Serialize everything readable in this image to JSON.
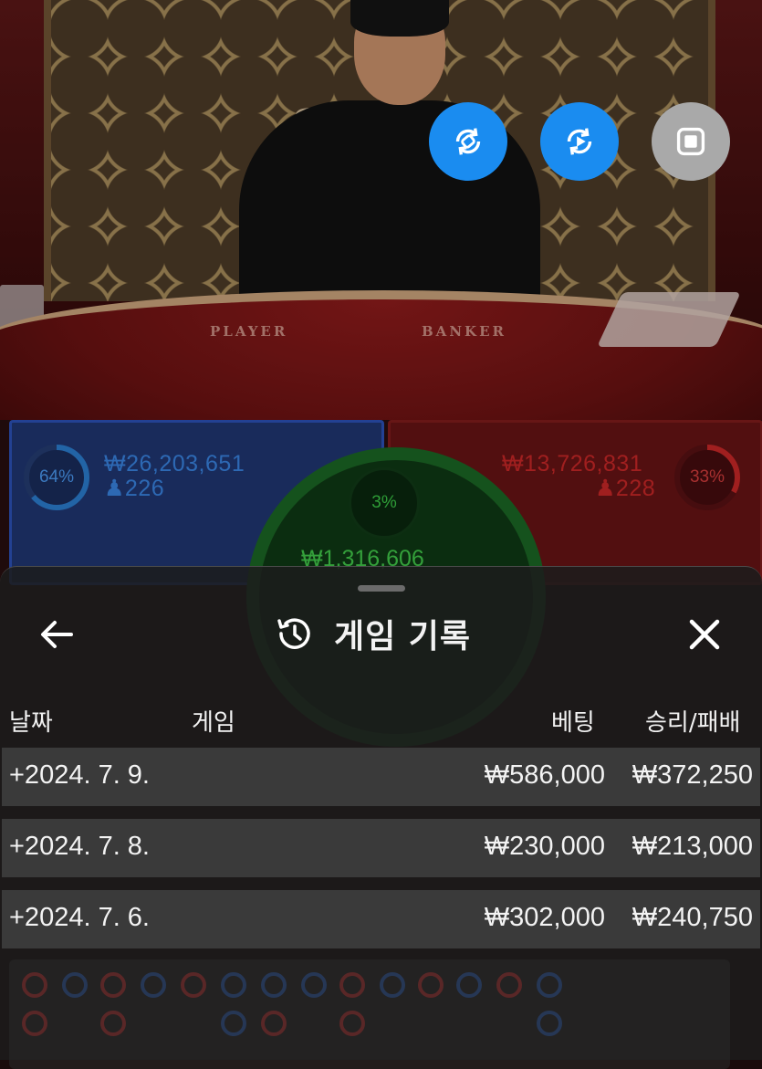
{
  "video": {
    "table_labels": {
      "player": "PLAYER",
      "banker": "BANKER"
    },
    "controls": [
      {
        "icon": "rotate-icon",
        "color": "#1a8cf0"
      },
      {
        "icon": "replay-icon",
        "color": "#1a8cf0"
      },
      {
        "icon": "stop-icon",
        "color": "#a9a9a9"
      }
    ]
  },
  "betting": {
    "player": {
      "percent": "64%",
      "percent_value": 0.64,
      "amount": "₩26,203,651",
      "players": "226",
      "color": "#2e86de"
    },
    "tie": {
      "percent": "3%",
      "percent_value": 0.03,
      "amount": "₩1,316,606",
      "color": "#46d64f"
    },
    "banker": {
      "percent": "33%",
      "percent_value": 0.33,
      "amount": "₩13,726,831",
      "players": "228",
      "color": "#d62a2a"
    }
  },
  "sheet": {
    "title": "게임 기록",
    "columns": {
      "date": "날짜",
      "game": "게임",
      "bet": "베팅",
      "result": "승리/패배"
    },
    "rows": [
      {
        "date": "+2024. 7. 9.",
        "bet": "₩586,000",
        "result": "₩372,250"
      },
      {
        "date": "+2024. 7. 8.",
        "bet": "₩230,000",
        "result": "₩213,000"
      },
      {
        "date": "+2024. 7. 6.",
        "bet": "₩302,000",
        "result": "₩240,750"
      }
    ]
  }
}
